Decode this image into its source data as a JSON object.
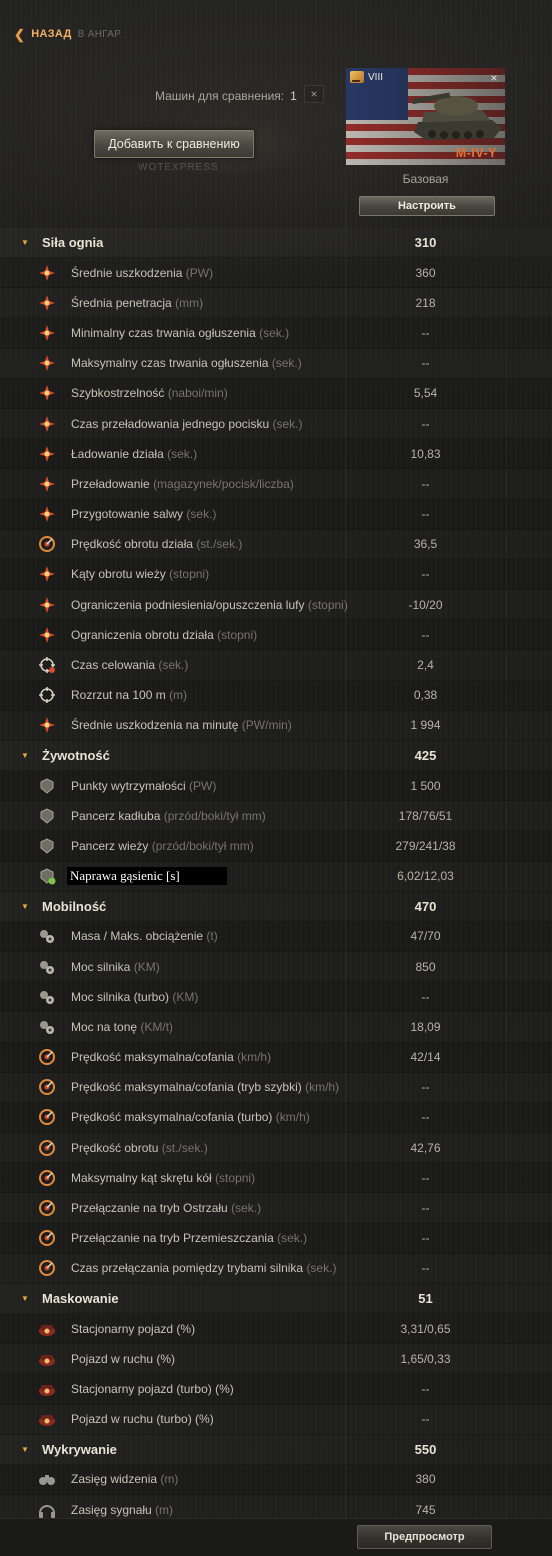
{
  "nav": {
    "back_label": "НАЗАД",
    "crumb_label": "В АНГАР"
  },
  "compare": {
    "label": "Машин для сравнения:",
    "count": "1",
    "clear_symbol": "×",
    "add_button": "Добавить к сравнению",
    "watermark": "WOTEXPRESS"
  },
  "vehicle": {
    "tier": "VIII",
    "name": "M-IV-Y",
    "config": "Базовая",
    "setup_button": "Настроить",
    "close_symbol": "×",
    "flag": "usa"
  },
  "sections": [
    {
      "name": "Siła ognia",
      "value": "310",
      "rows": [
        {
          "label": "Średnie uszkodzenia",
          "unit": "(PW)",
          "value": "360",
          "icon": "damage-icon"
        },
        {
          "label": "Średnia penetracja",
          "unit": "(mm)",
          "value": "218",
          "icon": "penetration-icon"
        },
        {
          "label": "Minimalny czas trwania ogłuszenia",
          "unit": "(sek.)",
          "value": "--",
          "icon": "stun-min-icon"
        },
        {
          "label": "Maksymalny czas trwania ogłuszenia",
          "unit": "(sek.)",
          "value": "--",
          "icon": "stun-max-icon"
        },
        {
          "label": "Szybkostrzelność",
          "unit": "(naboi/min)",
          "value": "5,54",
          "icon": "rate-of-fire-icon"
        },
        {
          "label": "Czas przeładowania jednego pocisku",
          "unit": "(sek.)",
          "value": "--",
          "icon": "shell-reload-icon"
        },
        {
          "label": "Ładowanie działa",
          "unit": "(sek.)",
          "value": "10,83",
          "icon": "reload-icon"
        },
        {
          "label": "Przeładowanie",
          "unit": "(magazynek/pocisk/liczba)",
          "value": "--",
          "icon": "magazine-icon"
        },
        {
          "label": "Przygotowanie salwy",
          "unit": "(sek.)",
          "value": "--",
          "icon": "salvo-icon"
        },
        {
          "label": "Prędkość obrotu działa",
          "unit": "(st./sek.)",
          "value": "36,5",
          "icon": "gun-traverse-icon"
        },
        {
          "label": "Kąty obrotu wieży",
          "unit": "(stopni)",
          "value": "--",
          "icon": "turret-angle-icon"
        },
        {
          "label": "Ograniczenia podniesienia/opuszczenia lufy",
          "unit": "(stopni)",
          "value": "-10/20",
          "icon": "elevation-icon"
        },
        {
          "label": "Ograniczenia obrotu działa",
          "unit": "(stopni)",
          "value": "--",
          "icon": "gun-arc-icon"
        },
        {
          "label": "Czas celowania",
          "unit": "(sek.)",
          "value": "2,4",
          "icon": "aim-time-icon"
        },
        {
          "label": "Rozrzut na 100 m",
          "unit": "(m)",
          "value": "0,38",
          "icon": "dispersion-icon"
        },
        {
          "label": "Średnie uszkodzenia na minutę",
          "unit": "(PW/min)",
          "value": "1 994",
          "icon": "dpm-icon"
        }
      ]
    },
    {
      "name": "Żywotność",
      "value": "425",
      "rows": [
        {
          "label": "Punkty wytrzymałości",
          "unit": "(PW)",
          "value": "1 500",
          "icon": "hit-points-icon"
        },
        {
          "label": "Pancerz kadłuba",
          "unit": "(przód/boki/tył mm)",
          "value": "178/76/51",
          "icon": "hull-armor-icon"
        },
        {
          "label": "Pancerz wieży",
          "unit": "(przód/boki/tył mm)",
          "value": "279/241/38",
          "icon": "turret-armor-icon"
        },
        {
          "label": "Naprawa gąsienic [s]",
          "unit": "",
          "value": "6,02/12,03",
          "icon": "track-repair-icon",
          "highlight": true
        }
      ]
    },
    {
      "name": "Mobilność",
      "value": "470",
      "rows": [
        {
          "label": "Masa / Maks. obciążenie",
          "unit": "(t)",
          "value": "47/70",
          "icon": "weight-icon"
        },
        {
          "label": "Moc silnika",
          "unit": "(KM)",
          "value": "850",
          "icon": "engine-icon"
        },
        {
          "label": "Moc silnika (turbo)",
          "unit": "(KM)",
          "value": "--",
          "icon": "engine-turbo-icon"
        },
        {
          "label": "Moc na tonę",
          "unit": "(KM/t)",
          "value": "18,09",
          "icon": "power-ratio-icon"
        },
        {
          "label": "Prędkość maksymalna/cofania",
          "unit": "(km/h)",
          "value": "42/14",
          "icon": "speed-icon"
        },
        {
          "label": "Prędkość maksymalna/cofania (tryb szybki)",
          "unit": "(km/h)",
          "value": "--",
          "icon": "speed-fast-icon"
        },
        {
          "label": "Prędkość maksymalna/cofania (turbo)",
          "unit": "(km/h)",
          "value": "--",
          "icon": "speed-turbo-icon"
        },
        {
          "label": "Prędkość obrotu",
          "unit": "(st./sek.)",
          "value": "42,76",
          "icon": "traverse-icon"
        },
        {
          "label": "Maksymalny kąt skrętu kół",
          "unit": "(stopni)",
          "value": "--",
          "icon": "wheel-angle-icon"
        },
        {
          "label": "Przełączanie na tryb Ostrzału ",
          "unit": "(sek.)",
          "value": "--",
          "icon": "siege-mode-icon"
        },
        {
          "label": "Przełączanie na tryb Przemieszczania ",
          "unit": "(sek.)",
          "value": "--",
          "icon": "travel-mode-icon"
        },
        {
          "label": "Czas przełączania pomiędzy trybami silnika",
          "unit": "(sek.)",
          "value": "--",
          "icon": "engine-mode-icon"
        }
      ]
    },
    {
      "name": "Maskowanie",
      "value": "51",
      "rows": [
        {
          "label": "Stacjonarny pojazd (%)",
          "unit": "",
          "value": "3,31/0,65",
          "icon": "camo-stationary-icon"
        },
        {
          "label": "Pojazd w ruchu (%)",
          "unit": "",
          "value": "1,65/0,33",
          "icon": "camo-moving-icon"
        },
        {
          "label": "Stacjonarny pojazd (turbo) (%)",
          "unit": "",
          "value": "--",
          "icon": "camo-stationary-turbo-icon"
        },
        {
          "label": "Pojazd w ruchu (turbo) (%)",
          "unit": "",
          "value": "--",
          "icon": "camo-moving-turbo-icon"
        }
      ]
    },
    {
      "name": "Wykrywanie",
      "value": "550",
      "rows": [
        {
          "label": "Zasięg widzenia",
          "unit": "(m)",
          "value": "380",
          "icon": "binoculars-icon"
        },
        {
          "label": "Zasięg sygnału",
          "unit": "(m)",
          "value": "745",
          "icon": "headphones-icon"
        }
      ]
    }
  ],
  "footer": {
    "preview_button": "Предпросмотр"
  },
  "colors": {
    "accent": "#e6a640",
    "vehicle_name": "#e8702e",
    "icon_red": "#d84a2a",
    "icon_green": "#7cc44a",
    "icon_grey": "#9a978e"
  }
}
